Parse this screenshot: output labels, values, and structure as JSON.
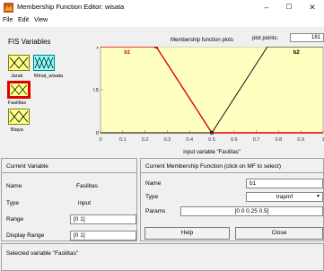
{
  "window": {
    "title": "Membership Function Editor: wisata",
    "minimize": "–",
    "maximize": "☐",
    "close": "✕"
  },
  "menu": {
    "file": "File",
    "edit": "Edit",
    "view": "View"
  },
  "fis": {
    "label": "FIS Variables",
    "inputs": [
      "Jarak",
      "Fasilitas",
      "Biaya"
    ],
    "output": "Minat_wisata",
    "selected": "Fasilitas"
  },
  "plot": {
    "title": "Membership function plots",
    "points_label": "plot points:",
    "points_value": "181",
    "xlabel": "input variable \"Fasilitas\"",
    "ticks": [
      "0",
      "0.1",
      "0.2",
      "0.3",
      "0.4",
      "0.5",
      "0.6",
      "0.7",
      "0.8",
      "0.9",
      "1"
    ],
    "yticks": [
      "1",
      "0.5",
      "0"
    ],
    "mf_names": [
      "b1",
      "b2"
    ],
    "colors": {
      "background": "#ffffc0",
      "selected_mf": "#e00000",
      "other_mf": "#000000"
    }
  },
  "chart_data": {
    "type": "line",
    "xlabel": "input variable \"Fasilitas\"",
    "xlim": [
      0,
      1
    ],
    "ylim": [
      0,
      1
    ],
    "series": [
      {
        "name": "b1",
        "x": [
          0,
          0.25,
          0.5,
          1
        ],
        "y": [
          1,
          1,
          0,
          0
        ],
        "color": "#e00000"
      },
      {
        "name": "b2",
        "x": [
          0,
          0.5,
          0.75,
          1
        ],
        "y": [
          0,
          0,
          1,
          1
        ],
        "color": "#000000"
      }
    ]
  },
  "current_variable": {
    "header": "Current Variable",
    "name_label": "Name",
    "name_value": "Fasilitas",
    "type_label": "Type",
    "type_value": "input",
    "range_label": "Range",
    "range_value": "[0 1]",
    "display_range_label": "Display Range",
    "display_range_value": "[0 1]"
  },
  "current_mf": {
    "header": "Current Membership Function (click on MF to select)",
    "name_label": "Name",
    "name_value": "b1",
    "type_label": "Type",
    "type_value": "trapmf",
    "params_label": "Params",
    "params_value": "[0 0 0.25 0.5]"
  },
  "buttons": {
    "help": "Help",
    "close": "Close"
  },
  "status": "Selected variable \"Fasilitas\""
}
